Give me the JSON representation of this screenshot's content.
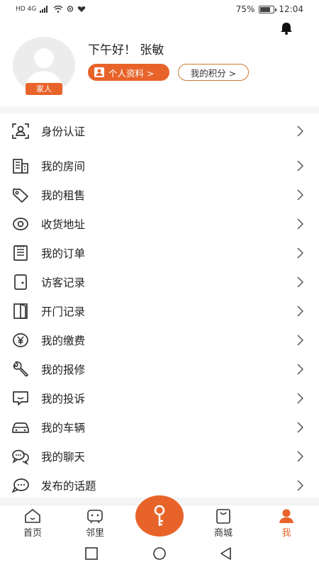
{
  "status_bar": {
    "left_indicators": "HD 4G",
    "battery_percent": "75%",
    "battery_level": 0.75,
    "time": "12:04"
  },
  "profile": {
    "greeting": "下午好！ 张敏",
    "role_badge": "家人",
    "profile_button": "个人资料 >",
    "points_button": "我的积分 >"
  },
  "menu": {
    "items": [
      {
        "label": "身份认证",
        "icon": "id-scan-icon"
      },
      {
        "label": "我的房间",
        "icon": "building-icon"
      },
      {
        "label": "我的租售",
        "icon": "tag-icon"
      },
      {
        "label": "收货地址",
        "icon": "location-pin-icon"
      },
      {
        "label": "我的订单",
        "icon": "order-list-icon"
      },
      {
        "label": "访客记录",
        "icon": "visitor-icon"
      },
      {
        "label": "开门记录",
        "icon": "door-icon"
      },
      {
        "label": "我的缴费",
        "icon": "yuan-coin-icon"
      },
      {
        "label": "我的报修",
        "icon": "wrench-icon"
      },
      {
        "label": "我的投诉",
        "icon": "complaint-chat-icon"
      },
      {
        "label": "我的车辆",
        "icon": "car-icon"
      },
      {
        "label": "我的聊天",
        "icon": "chat-bubbles-icon"
      },
      {
        "label": "发布的话题",
        "icon": "topic-bubble-icon"
      }
    ]
  },
  "tabs": [
    {
      "label": "首页",
      "icon": "home-icon"
    },
    {
      "label": "邻里",
      "icon": "neighbor-icon"
    },
    {
      "label": "",
      "icon": "key-icon"
    },
    {
      "label": "商城",
      "icon": "shop-bag-icon"
    },
    {
      "label": "我",
      "icon": "person-icon",
      "active": true
    }
  ],
  "colors": {
    "accent": "#e8632a",
    "text": "#222222",
    "band": "#f5f5f5"
  }
}
